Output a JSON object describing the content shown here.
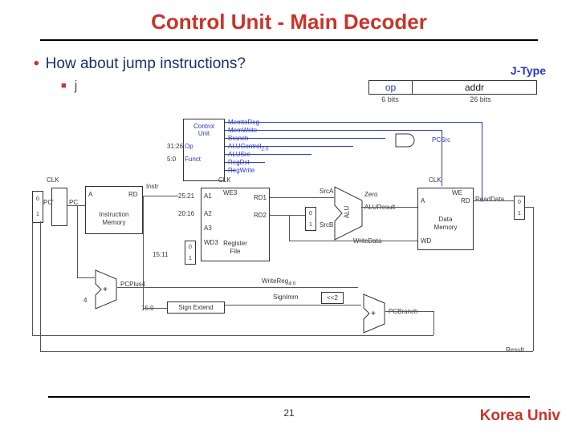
{
  "title": "Control Unit - Main Decoder",
  "bullet_main": "How about jump instructions?",
  "bullet_sub": "j",
  "jtype": {
    "label": "J-Type",
    "op": "op",
    "addr": "addr",
    "bits_op": "6 bits",
    "bits_addr": "26 bits"
  },
  "pagenum": "21",
  "brand": "Korea Univ",
  "diag": {
    "clk": "CLK",
    "pc": "PC",
    "pc_in": "PC'",
    "imem": "Instruction\nMemory",
    "a": "A",
    "rd": "RD",
    "instr": "Instr",
    "bits31_26": "31:26",
    "bits5_0": "5:0",
    "bits25_21": "25:21",
    "bits20_16": "20:16",
    "bits15_11": "15:11",
    "bits15_0": "15:0",
    "cu": "Control\nUnit",
    "op": "Op",
    "funct": "Funct",
    "mtoreg": "MemtoReg",
    "mwrite": "MemWrite",
    "branch": "Branch",
    "aluctrl": "ALUControl",
    "aluctrl_sub": "2:0",
    "alusrc": "ALUSrc",
    "regdst": "RegDst",
    "regwrite": "RegWrite",
    "we3": "WE3",
    "a1": "A1",
    "a2": "A2",
    "a3": "A3",
    "wd3": "WD3",
    "rd1": "RD1",
    "rd2": "RD2",
    "regfile": "Register\nFile",
    "srca": "SrcA",
    "srcb": "SrcB",
    "alu": "ALU",
    "zero": "Zero",
    "alures": "ALUResult",
    "writedata": "WriteData",
    "dmem": "Data\nMemory",
    "we": "WE",
    "wd": "WD",
    "readdata": "ReadData",
    "writereg": "WriteReg",
    "writereg_sub": "4:0",
    "signex": "Sign Extend",
    "signimm": "SignImm",
    "sl2": "<<2",
    "pcplus4": "PCPlus4",
    "plus": "+",
    "four": "4",
    "pcsrc": "PCSrc",
    "pcbranch": "PCBranch",
    "result": "Result",
    "m0": "0",
    "m1": "1"
  }
}
